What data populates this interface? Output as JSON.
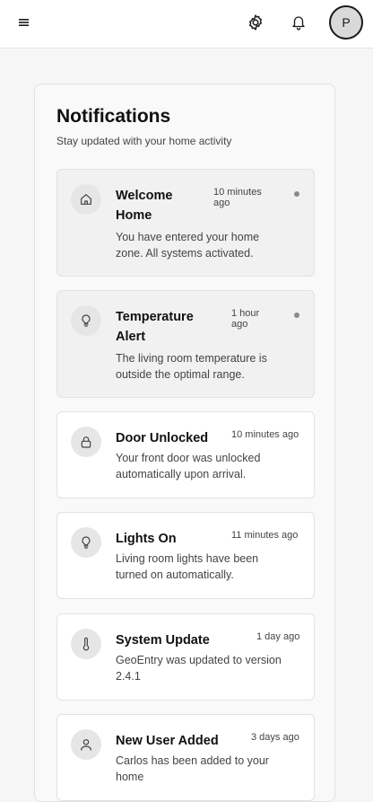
{
  "header": {
    "menu_icon": "hamburger-menu-icon",
    "settings_icon": "gear-icon",
    "notifications_icon": "bell-icon",
    "avatar_initial": "P"
  },
  "notifications": {
    "title": "Notifications",
    "subtitle": "Stay updated with your home activity",
    "items": [
      {
        "icon": "home-icon",
        "title_lines": [
          "Welcome",
          "Home"
        ],
        "time_lines": [
          "10 minutes",
          "ago"
        ],
        "message_lines": [
          "You have entered your home",
          "zone. All systems activated."
        ],
        "unread": true
      },
      {
        "icon": "lightbulb-icon",
        "title_lines": [
          "Temperature",
          "Alert"
        ],
        "time_lines": [
          "1 hour",
          "ago"
        ],
        "message_lines": [
          "The living room temperature is",
          "outside the optimal range."
        ],
        "unread": true
      },
      {
        "icon": "lock-icon",
        "title_lines": [
          "Door Unlocked"
        ],
        "time_lines": [
          "10 minutes ago"
        ],
        "message_lines": [
          "Your front door was unlocked",
          "automatically upon arrival."
        ],
        "unread": false
      },
      {
        "icon": "lightbulb-icon",
        "title_lines": [
          "Lights On"
        ],
        "time_lines": [
          "11 minutes ago"
        ],
        "message_lines": [
          "Living room lights have been",
          "turned on automatically."
        ],
        "unread": false
      },
      {
        "icon": "thermometer-icon",
        "title_lines": [
          "System Update"
        ],
        "time_lines": [
          "1 day ago"
        ],
        "message_lines": [
          "GeoEntry was updated to version",
          "2.4.1"
        ],
        "unread": false
      },
      {
        "icon": "user-icon",
        "title_lines": [
          "New User Added"
        ],
        "time_lines": [
          "3 days ago"
        ],
        "message_lines": [
          "Carlos has been added to your",
          "home"
        ],
        "unread": false
      }
    ]
  }
}
